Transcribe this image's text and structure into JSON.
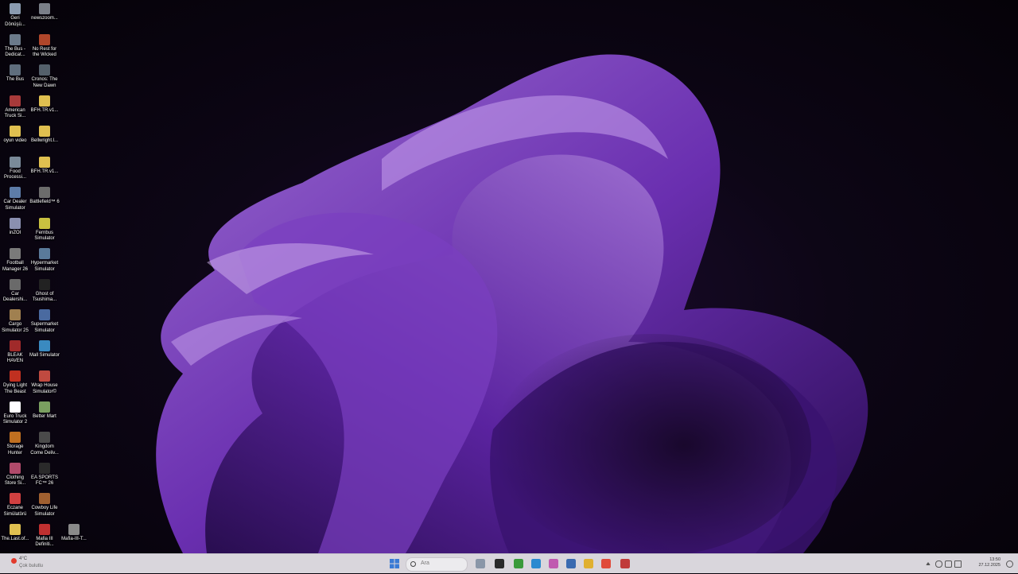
{
  "desktop": {
    "icons": [
      {
        "label": "Geri Dönüşü...",
        "color": "#8a9bb0"
      },
      {
        "label": "newszoom...",
        "color": "#7a7f88"
      },
      {
        "label": "The Bus - Dedicat...",
        "color": "#6b7a8a"
      },
      {
        "label": "No Rest for the Wicked",
        "color": "#b0462a"
      },
      {
        "label": "The Bus",
        "color": "#5f6e7d"
      },
      {
        "label": "Cronos: The New Dawn",
        "color": "#54606b"
      },
      {
        "label": "American Truck Si...",
        "color": "#a83a3a"
      },
      {
        "label": "BFH.TR.v1...",
        "color": "#e0c050"
      },
      {
        "label": "oyun video",
        "color": "#e0c050"
      },
      {
        "label": "Bellwright.l...",
        "color": "#e0c050"
      },
      {
        "label": "Food Processi...",
        "color": "#7a8a99"
      },
      {
        "label": "BFH.TR.v1...",
        "color": "#e0c050"
      },
      {
        "label": "Car Dealer Simulator",
        "color": "#5d7ca8"
      },
      {
        "label": "Battlefield™ 6",
        "color": "#6c6c6c"
      },
      {
        "label": "inZOI",
        "color": "#8a8fb0"
      },
      {
        "label": "Fernbus Simulator",
        "color": "#c8c040"
      },
      {
        "label": "Football Manager 26",
        "color": "#7a7a7a"
      },
      {
        "label": "Hypermarket Simulator",
        "color": "#5a7a9a"
      },
      {
        "label": "Car Dealershi...",
        "color": "#6a6a6a"
      },
      {
        "label": "Ghost of Tsushima...",
        "color": "#222222"
      },
      {
        "label": "Cargo Simulator 25",
        "color": "#a08050"
      },
      {
        "label": "Supermarket Simulator",
        "color": "#4a6aa0"
      },
      {
        "label": "BLEAK HAVEN",
        "color": "#a02a2a"
      },
      {
        "label": "Mall Simulator",
        "color": "#3a8ac0"
      },
      {
        "label": "Dying Light The Beast",
        "color": "#c03020"
      },
      {
        "label": "Wrap House Simulator©",
        "color": "#c04a40"
      },
      {
        "label": "Euro Truck Simulator 2",
        "color": "#ffffff"
      },
      {
        "label": "Better Mart",
        "color": "#7aa060"
      },
      {
        "label": "Storage Hunter",
        "color": "#c07020"
      },
      {
        "label": "Kingdom Come Deliv...",
        "color": "#4a4a4a"
      },
      {
        "label": "Clothing Store Si...",
        "color": "#b04a6a"
      },
      {
        "label": "EA SPORTS FC™ 26",
        "color": "#2a2a2a"
      },
      {
        "label": "Eczane Simülatörü",
        "color": "#d04040"
      },
      {
        "label": "Cowboy Life Simulator",
        "color": "#a06030"
      },
      {
        "label": "The.Last.of...",
        "color": "#e0c050"
      },
      {
        "label": "Mafia III Definiti...",
        "color": "#c03030"
      },
      {
        "label": "Mafia-III-T...",
        "color": "#8a8a8a"
      }
    ]
  },
  "taskbar": {
    "weather": {
      "temp": "4°C",
      "desc": "Çok bulutlu"
    },
    "search_placeholder": "Ara",
    "apps": [
      {
        "name": "start-button",
        "color": "#3a7bd5"
      },
      {
        "name": "widgets-icon",
        "color": "#8a96a8"
      },
      {
        "name": "terminal-icon",
        "color": "#2a2a2a"
      },
      {
        "name": "xbox-icon",
        "color": "#3a9a3a"
      },
      {
        "name": "edge-icon",
        "color": "#2a8ad0"
      },
      {
        "name": "app-icon",
        "color": "#c05ab0"
      },
      {
        "name": "store-icon",
        "color": "#3a6ab0"
      },
      {
        "name": "file-explorer-icon",
        "color": "#e0b030"
      },
      {
        "name": "chrome-icon",
        "color": "#e04a3a"
      },
      {
        "name": "app2-icon",
        "color": "#c03a3a"
      }
    ],
    "clock": {
      "time": "13:50",
      "date": "27.12.2025"
    }
  }
}
